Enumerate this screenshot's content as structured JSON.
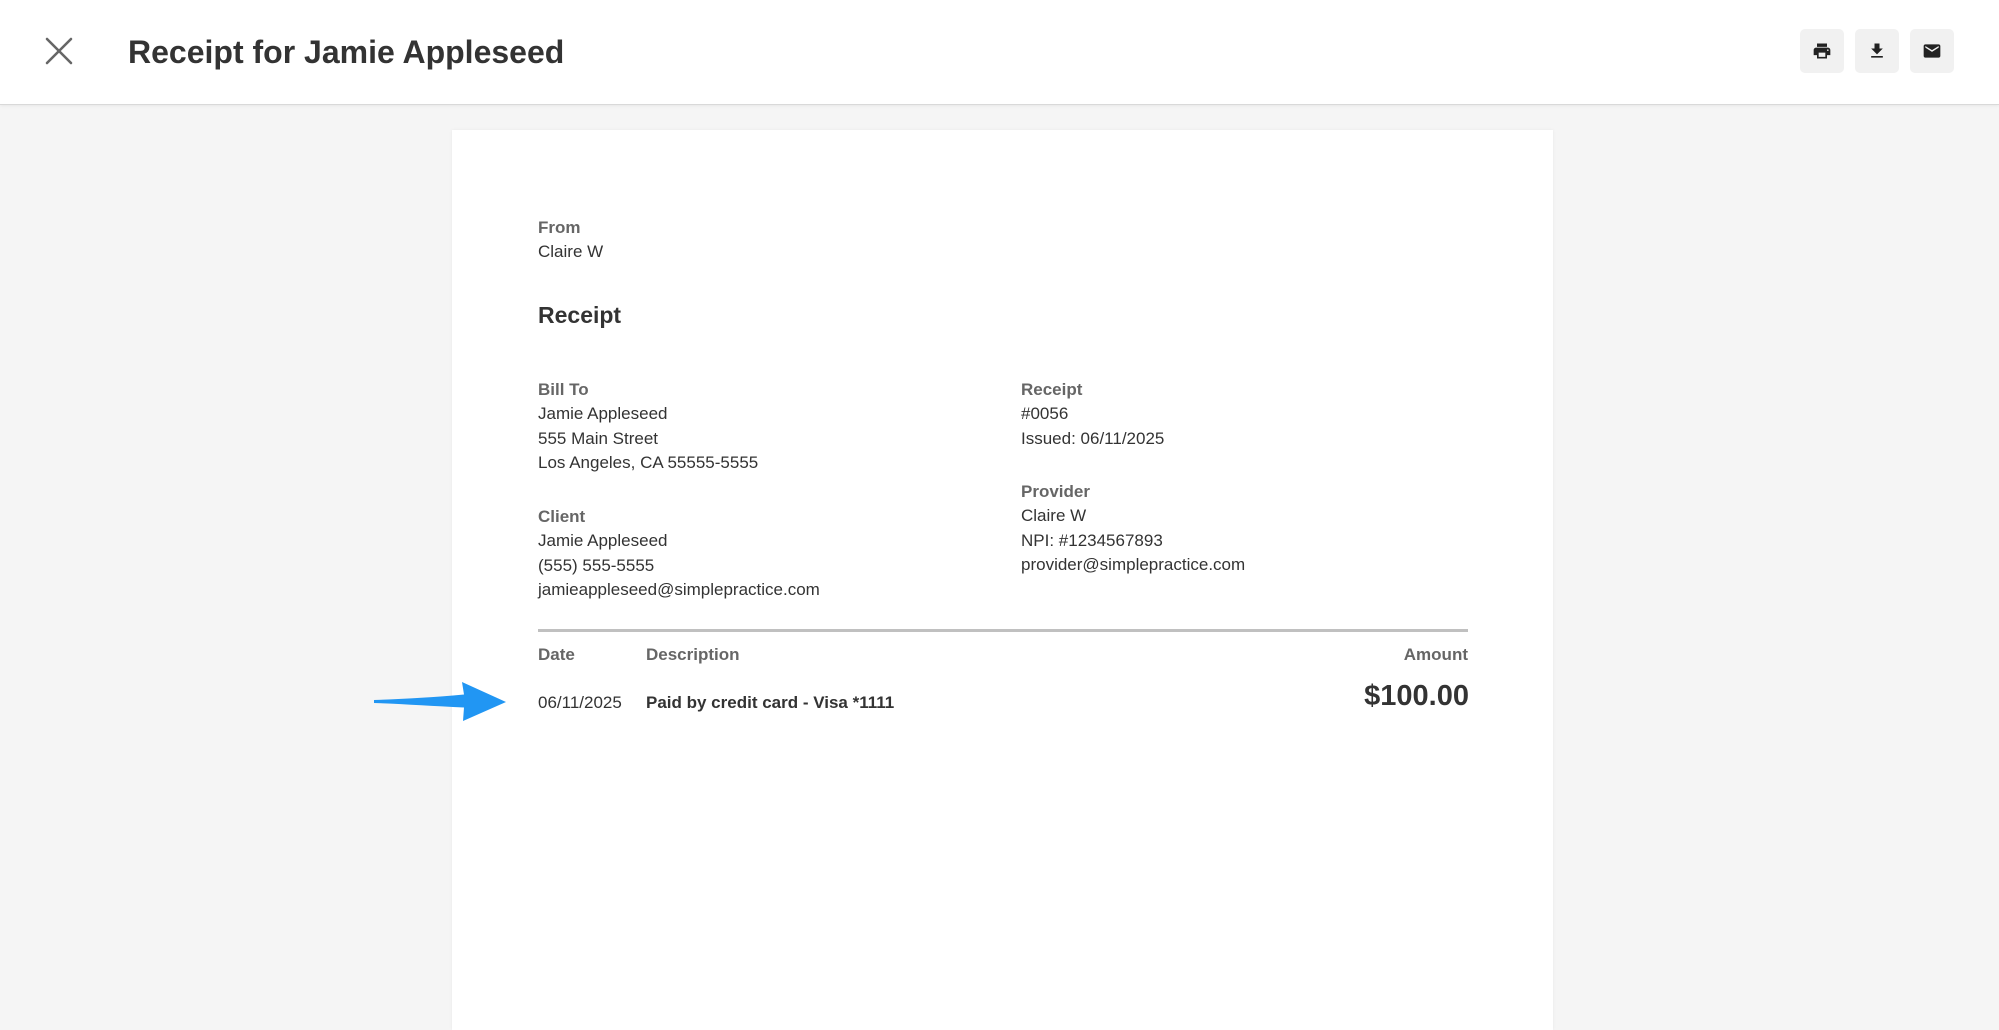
{
  "header": {
    "title": "Receipt for Jamie Appleseed",
    "close_icon": "close-icon",
    "actions": [
      {
        "name": "print-button",
        "icon": "printer-icon"
      },
      {
        "name": "download-button",
        "icon": "download-icon"
      },
      {
        "name": "email-button",
        "icon": "envelope-icon"
      }
    ]
  },
  "from": {
    "label": "From",
    "name": "Claire W"
  },
  "receipt_heading": "Receipt",
  "bill_to": {
    "label": "Bill To",
    "name": "Jamie Appleseed",
    "street": "555 Main Street",
    "city": "Los Angeles, CA 55555-5555"
  },
  "client": {
    "label": "Client",
    "name": "Jamie Appleseed",
    "phone": "(555) 555-5555",
    "email": "jamieappleseed@simplepractice.com"
  },
  "receipt_info": {
    "label": "Receipt",
    "number": "#0056",
    "issued": "Issued: 06/11/2025"
  },
  "provider": {
    "label": "Provider",
    "name": "Claire W",
    "npi": "NPI: #1234567893",
    "email": "provider@simplepractice.com"
  },
  "table": {
    "headers": {
      "date": "Date",
      "description": "Description",
      "amount": "Amount"
    },
    "rows": [
      {
        "date": "06/11/2025",
        "description": "Paid by credit card - Visa *1111",
        "amount": "$100.00"
      }
    ]
  },
  "colors": {
    "accent_arrow": "#2196f3",
    "background": "#f5f5f5",
    "text": "#333333",
    "label": "#666666"
  }
}
